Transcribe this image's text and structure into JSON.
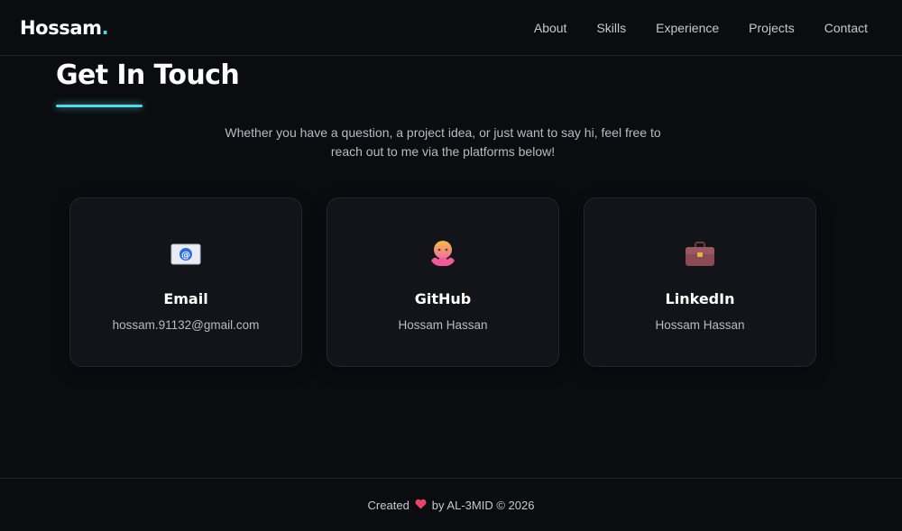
{
  "nav": {
    "logo_text": "Hossam",
    "logo_dot": ".",
    "links": [
      {
        "label": "About"
      },
      {
        "label": "Skills"
      },
      {
        "label": "Experience"
      },
      {
        "label": "Projects"
      },
      {
        "label": "Contact"
      }
    ]
  },
  "section": {
    "title": "Get In Touch",
    "intro": "Whether you have a question, a project idea, or just want to say hi, feel free to reach out to me via the platforms below!"
  },
  "cards": [
    {
      "title": "Email",
      "value": "hossam.91132@gmail.com",
      "icon": "email-envelope-icon"
    },
    {
      "title": "GitHub",
      "value": "Hossam Hassan",
      "icon": "octopus-icon"
    },
    {
      "title": "LinkedIn",
      "value": "Hossam Hassan",
      "icon": "briefcase-icon"
    }
  ],
  "footer": {
    "prefix": "Created",
    "heart_icon": "heart-icon",
    "suffix": "by AL-3MID © 2026"
  },
  "colors": {
    "background": "#0b0c10",
    "card_background": "#121419",
    "accent": "#56d8e4",
    "heart": "#e8436a"
  }
}
